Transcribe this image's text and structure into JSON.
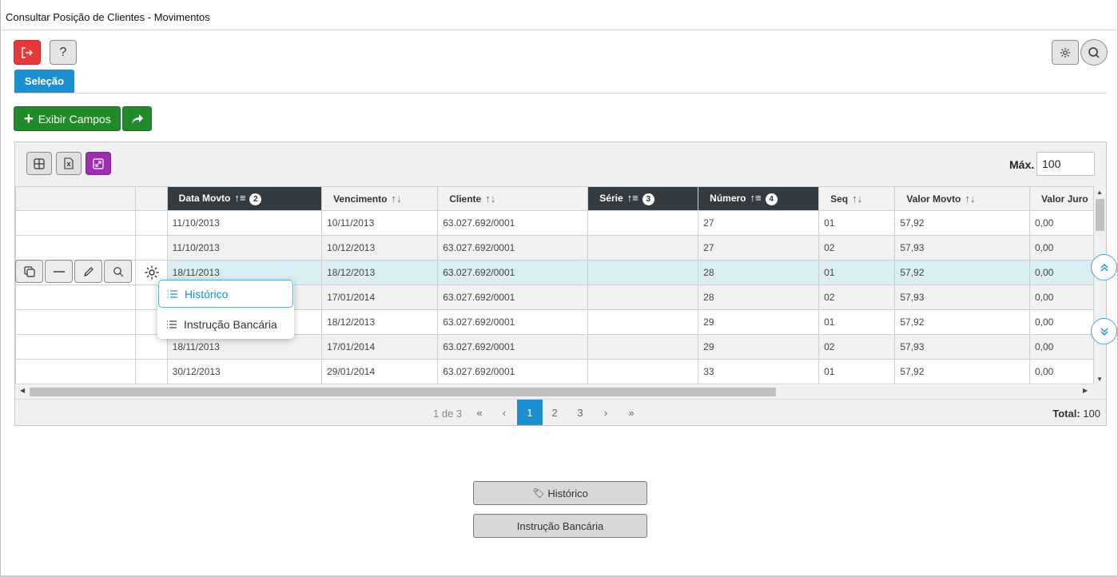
{
  "window": {
    "title": "Consultar Posição de Clientes - Movimentos"
  },
  "toolbar": {
    "exit_icon": "exit-icon",
    "help_label": "?",
    "settings_icon": "gear-icon",
    "search_icon": "search-icon"
  },
  "tabs": [
    {
      "label": "Seleção",
      "active": true
    }
  ],
  "actions": {
    "exibir_campos_label": "Exibir Campos",
    "share_icon": "share-arrow-icon"
  },
  "grid": {
    "toolbar_icons": [
      "grid-icon",
      "excel-icon",
      "expand-icon"
    ],
    "max_label": "Máx.",
    "max_value": "100",
    "columns": [
      {
        "label": "Data Movto",
        "sorted": true,
        "sort_order": "2"
      },
      {
        "label": "Vencimento",
        "sorted": false,
        "sort_order": ""
      },
      {
        "label": "Cliente",
        "sorted": false,
        "sort_order": ""
      },
      {
        "label": "Série",
        "sorted": true,
        "sort_order": "3"
      },
      {
        "label": "Número",
        "sorted": true,
        "sort_order": "4"
      },
      {
        "label": "Seq",
        "sorted": false,
        "sort_order": ""
      },
      {
        "label": "Valor Movto",
        "sorted": false,
        "sort_order": ""
      },
      {
        "label": "Valor Juro",
        "sorted": false,
        "sort_order": ""
      }
    ],
    "rows": [
      [
        "11/10/2013",
        "10/11/2013",
        "63.027.692/0001",
        "",
        "27",
        "01",
        "57,92",
        "0,00"
      ],
      [
        "11/10/2013",
        "10/12/2013",
        "63.027.692/0001",
        "",
        "27",
        "02",
        "57,93",
        "0,00"
      ],
      [
        "18/11/2013",
        "18/12/2013",
        "63.027.692/0001",
        "",
        "28",
        "01",
        "57,92",
        "0,00"
      ],
      [
        "",
        "17/01/2014",
        "63.027.692/0001",
        "",
        "28",
        "02",
        "57,93",
        "0,00"
      ],
      [
        "",
        "18/12/2013",
        "63.027.692/0001",
        "",
        "29",
        "01",
        "57,92",
        "0,00"
      ],
      [
        "18/11/2013",
        "17/01/2014",
        "63.027.692/0001",
        "",
        "29",
        "02",
        "57,93",
        "0,00"
      ],
      [
        "30/12/2013",
        "29/01/2014",
        "63.027.692/0001",
        "",
        "33",
        "01",
        "57,92",
        "0,00"
      ]
    ],
    "selected_row": 2,
    "row_actions": [
      "copy-icon",
      "minus-icon",
      "pencil-icon",
      "search-icon"
    ],
    "pager": {
      "info": "1 de 3",
      "first": "«",
      "prev": "‹",
      "pages": [
        "1",
        "2",
        "3"
      ],
      "current_page": "1",
      "next": "›",
      "last": "»",
      "total_label": "Total:",
      "total_value": "100"
    }
  },
  "context_menu": {
    "items": [
      {
        "label": "Histórico",
        "icon": "list-icon"
      },
      {
        "label": "Instrução Bancária",
        "icon": "list-icon"
      }
    ]
  },
  "bottom_buttons": {
    "historico_label": "Histórico",
    "instrucao_label": "Instrução Bancária"
  },
  "colors": {
    "accent": "#1d8fd0",
    "exit": "#e8383c",
    "primary_green": "#238a2c",
    "purple": "#9b2fae",
    "header_sorted": "#333a40",
    "row_selected": "#d9edf2"
  }
}
